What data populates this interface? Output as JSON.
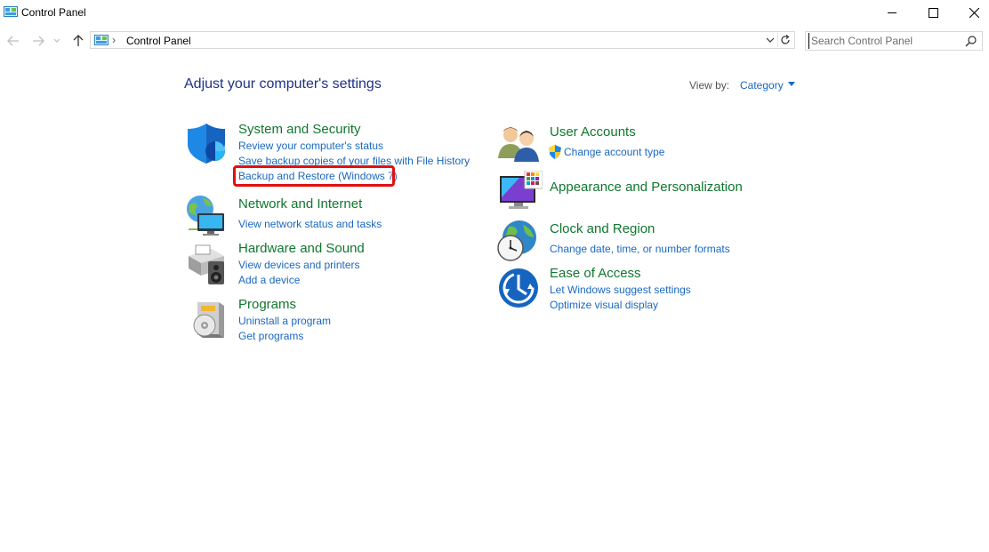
{
  "window": {
    "title": "Control Panel",
    "controls": [
      "minimize",
      "maximize",
      "close"
    ]
  },
  "nav": {
    "back_icon": "arrow-left-icon",
    "forward_icon": "arrow-right-icon",
    "recent_icon": "chevron-down-icon",
    "up_icon": "arrow-up-icon",
    "breadcrumb": [
      "Control Panel"
    ],
    "search_placeholder": "Search Control Panel"
  },
  "main": {
    "heading": "Adjust your computer's settings",
    "view_by_label": "View by:",
    "view_by_value": "Category"
  },
  "categories_left": [
    {
      "title": "System and Security",
      "icon": "shield-icon",
      "links": [
        "Review your computer's status",
        "Save backup copies of your files with File History",
        "Backup and Restore (Windows 7)"
      ]
    },
    {
      "title": "Network and Internet",
      "icon": "network-globe-icon",
      "links": [
        "View network status and tasks"
      ]
    },
    {
      "title": "Hardware and Sound",
      "icon": "printer-speaker-icon",
      "links": [
        "View devices and printers",
        "Add a device"
      ]
    },
    {
      "title": "Programs",
      "icon": "programs-box-icon",
      "links": [
        "Uninstall a program",
        "Get programs"
      ]
    }
  ],
  "categories_right": [
    {
      "title": "User Accounts",
      "icon": "users-icon",
      "links": [
        "Change account type"
      ]
    },
    {
      "title": "Appearance and Personalization",
      "icon": "monitor-palette-icon",
      "links": []
    },
    {
      "title": "Clock and Region",
      "icon": "clock-globe-icon",
      "links": [
        "Change date, time, or number formats"
      ]
    },
    {
      "title": "Ease of Access",
      "icon": "ease-of-access-icon",
      "links": [
        "Let Windows suggest settings",
        "Optimize visual display"
      ]
    }
  ],
  "colors": {
    "category_title": "#10772e",
    "link": "#1a68c2",
    "heading": "#1e3287",
    "highlight": "#e01010"
  }
}
